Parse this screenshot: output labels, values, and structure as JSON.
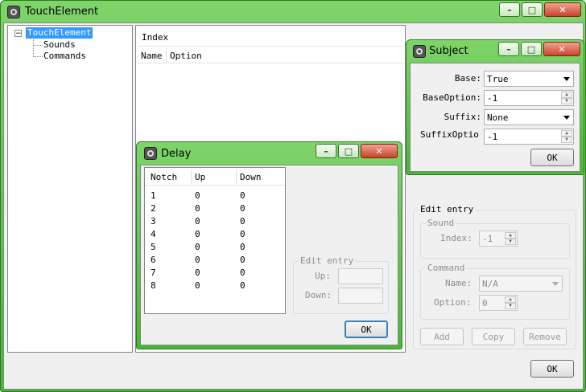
{
  "main_window": {
    "title": "TouchElement",
    "ok_label": "OK",
    "tree": {
      "root": "TouchElement",
      "children": [
        "Sounds",
        "Commands"
      ],
      "expander": "−"
    },
    "index_panel": {
      "header": "Index",
      "columns": [
        "Name",
        "Option"
      ]
    },
    "edit_entry": {
      "title": "Edit entry",
      "sound": {
        "title": "Sound",
        "index_label": "Index:",
        "index_value": "-1"
      },
      "command": {
        "title": "Command",
        "name_label": "Name:",
        "name_value": "N/A",
        "option_label": "Option:",
        "option_value": "0"
      },
      "buttons": {
        "add": "Add",
        "copy": "Copy",
        "remove": "Remove"
      }
    }
  },
  "subject_dialog": {
    "title": "Subject",
    "base_label": "Base:",
    "base_value": "True",
    "base_option_label": "BaseOption:",
    "base_option_value": "-1",
    "suffix_label": "Suffix:",
    "suffix_value": "None",
    "suffix_option_label": "SuffixOptio",
    "suffix_option_value": "-1",
    "ok_label": "OK"
  },
  "delay_dialog": {
    "title": "Delay",
    "columns": [
      "Notch",
      "Up",
      "Down"
    ],
    "rows": [
      [
        "1",
        "0",
        "0"
      ],
      [
        "2",
        "0",
        "0"
      ],
      [
        "3",
        "0",
        "0"
      ],
      [
        "4",
        "0",
        "0"
      ],
      [
        "5",
        "0",
        "0"
      ],
      [
        "6",
        "0",
        "0"
      ],
      [
        "7",
        "0",
        "0"
      ],
      [
        "8",
        "0",
        "0"
      ]
    ],
    "edit_entry": {
      "title": "Edit entry",
      "up_label": "Up:",
      "down_label": "Down:"
    },
    "ok_label": "OK"
  },
  "caption_buttons": {
    "minimize": "–",
    "maximize": "□",
    "close": "✕"
  }
}
